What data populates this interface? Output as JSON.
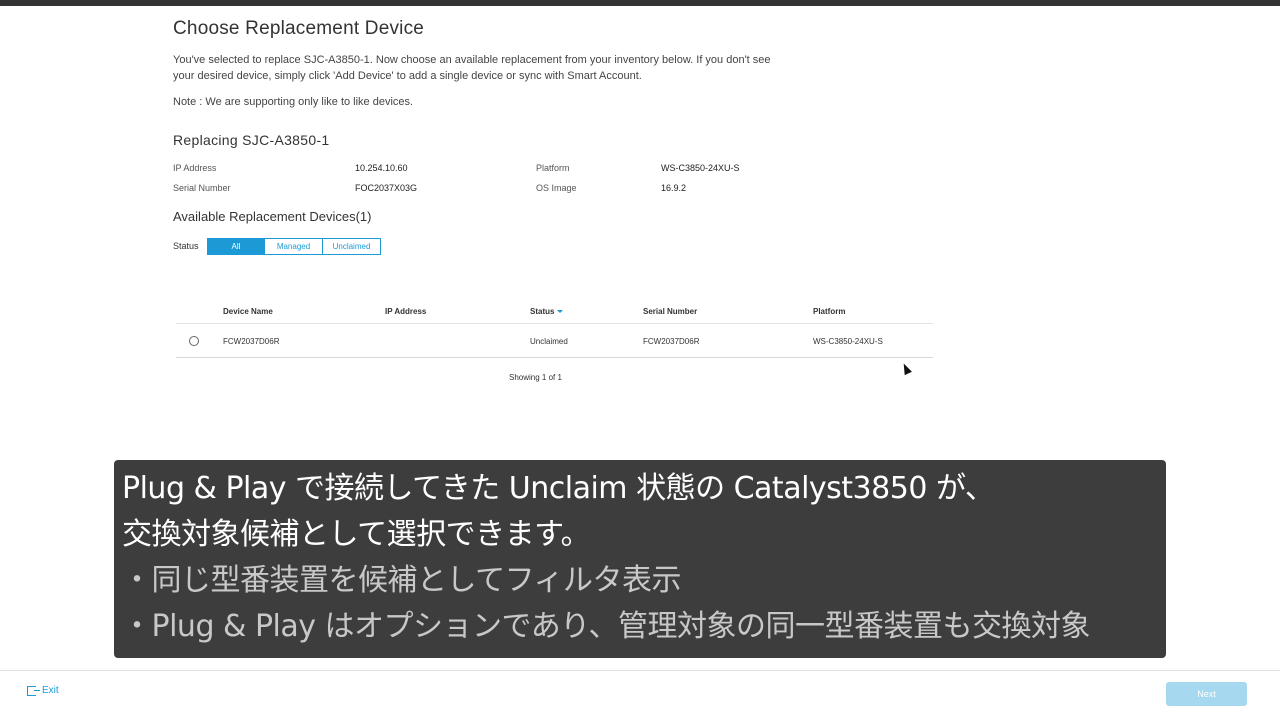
{
  "page": {
    "title": "Choose Replacement Device",
    "description": "You've selected to replace SJC-A3850-1. Now choose an available replacement from your inventory below. If you don't see your desired device, simply click 'Add Device' to add a single device or sync with Smart Account.",
    "note": "Note : We are supporting only like to like devices."
  },
  "replacing": {
    "title": "Replacing SJC-A3850-1",
    "ip_label": "IP Address",
    "ip_value": "10.254.10.60",
    "serial_label": "Serial Number",
    "serial_value": "FOC2037X03G",
    "platform_label": "Platform",
    "platform_value": "WS-C3850-24XU-S",
    "os_label": "OS Image",
    "os_value": "16.9.2"
  },
  "available": {
    "title": "Available Replacement Devices(1)",
    "status_label": "Status",
    "filters": [
      "All",
      "Managed",
      "Unclaimed"
    ],
    "active_filter": "All"
  },
  "table": {
    "headers": [
      "Device Name",
      "IP Address",
      "Status",
      "Serial Number",
      "Platform"
    ],
    "rows": [
      {
        "device_name": "FCW2037D06R",
        "ip_address": "",
        "status": "Unclaimed",
        "serial_number": "FCW2037D06R",
        "platform": "WS-C3850-24XU-S"
      }
    ],
    "showing": "Showing 1 of 1"
  },
  "caption": {
    "line1": "Plug & Play で接続してきた Unclaim 状態の Catalyst3850 が、",
    "line2": "交換対象候補として選択できます。",
    "line3": "・同じ型番装置を候補としてフィルタ表示",
    "line4": "・Plug & Play はオプションであり、管理対象の同一型番装置も交換対象"
  },
  "footer": {
    "exit_label": "Exit",
    "next_label": "Next"
  },
  "colors": {
    "accent": "#1b9ad6",
    "caption_bg": "#3d3d3d",
    "next_disabled": "#a6d8ef"
  }
}
